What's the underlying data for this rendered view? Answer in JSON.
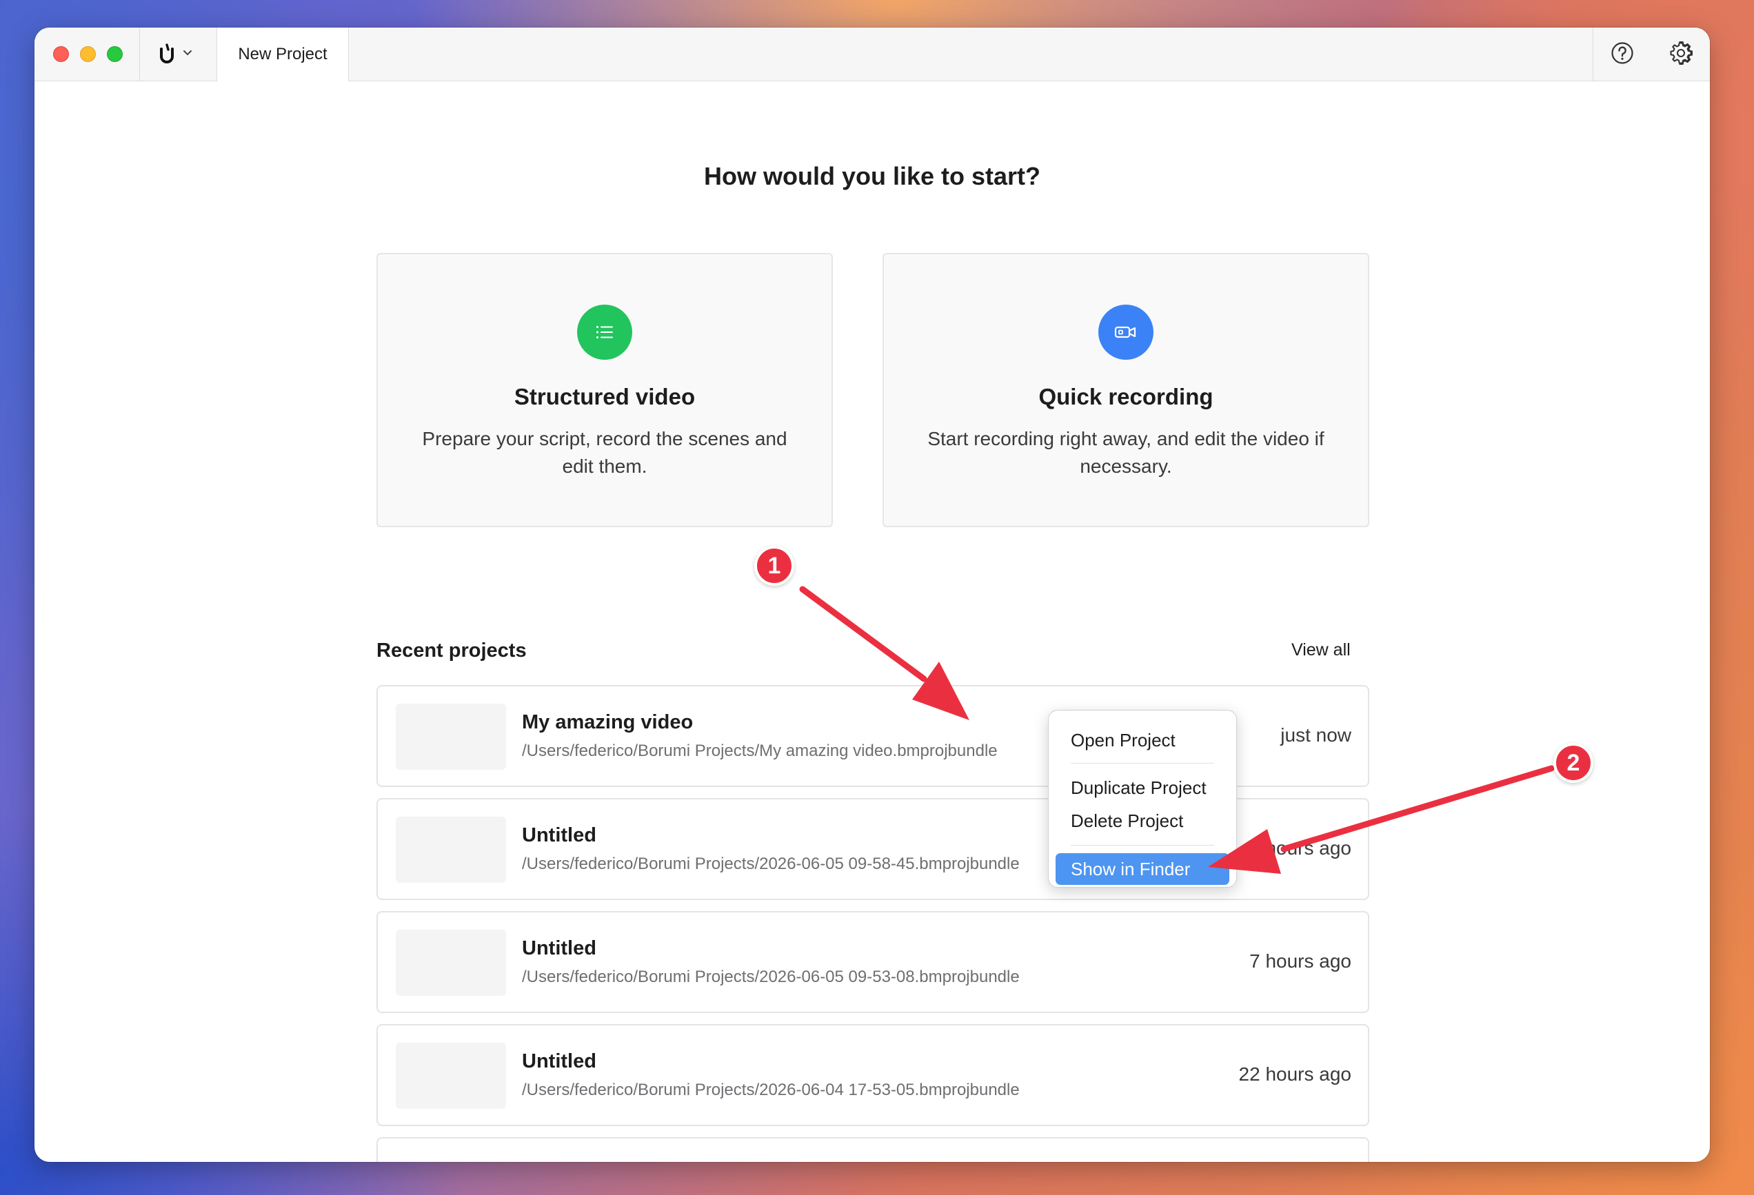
{
  "window": {
    "tab_title": "New Project",
    "app_menu_icon": "borumi-logo-icon",
    "toolbar_icons": [
      "help-icon",
      "gear-icon"
    ]
  },
  "start": {
    "heading": "How would you like to start?",
    "options": [
      {
        "title": "Structured video",
        "description": "Prepare your script, record the scenes and edit them.",
        "icon": "list-icon",
        "color": "#22c45e"
      },
      {
        "title": "Quick recording",
        "description": "Start recording right away, and edit the video if necessary.",
        "icon": "video-camera-icon",
        "color": "#3b82f6"
      }
    ]
  },
  "recent": {
    "title": "Recent projects",
    "view_all": "View all",
    "projects": [
      {
        "name": "My amazing video",
        "path": "/Users/federico/Borumi Projects/My amazing video.bmprojbundle",
        "time": "just now"
      },
      {
        "name": "Untitled",
        "path": "/Users/federico/Borumi Projects/2026-06-05 09-58-45.bmprojbundle",
        "time": "7 hours ago"
      },
      {
        "name": "Untitled",
        "path": "/Users/federico/Borumi Projects/2026-06-05 09-53-08.bmprojbundle",
        "time": "7 hours ago"
      },
      {
        "name": "Untitled",
        "path": "/Users/federico/Borumi Projects/2026-06-04 17-53-05.bmprojbundle",
        "time": "22 hours ago"
      }
    ]
  },
  "context_menu": {
    "items": [
      "Open Project",
      "Duplicate Project",
      "Delete Project",
      "Show in Finder"
    ],
    "highlighted": "Show in Finder"
  },
  "annotations": {
    "badge_1": "1",
    "badge_2": "2",
    "color": "#ea3040"
  }
}
